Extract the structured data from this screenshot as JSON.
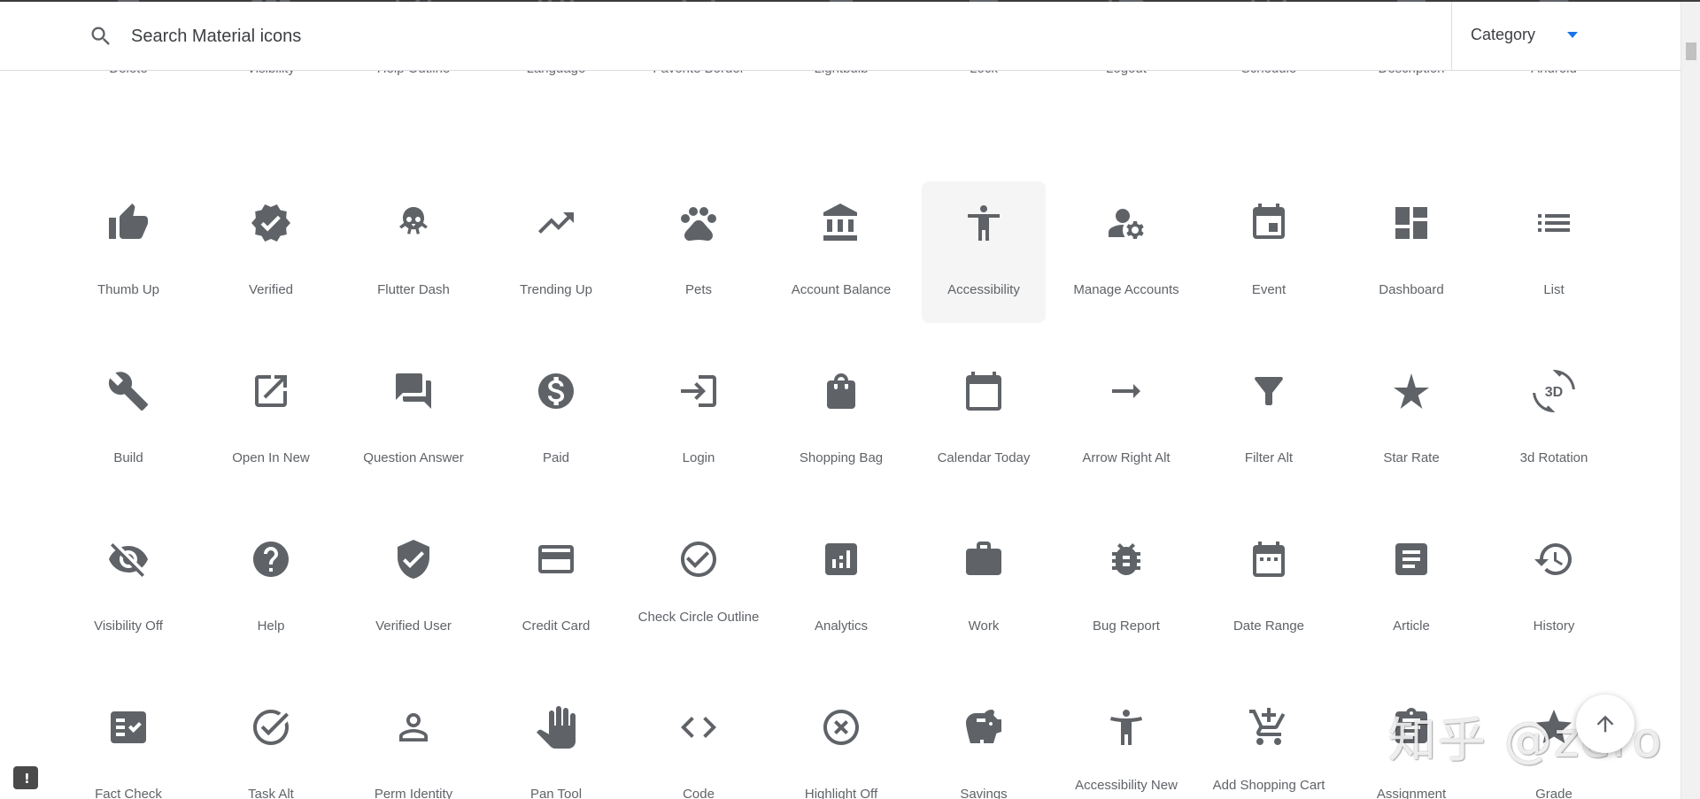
{
  "search": {
    "placeholder": "Search Material icons",
    "icon": "search-icon"
  },
  "category": {
    "label": "Category",
    "accent_color": "#1a73e8"
  },
  "selected_icon": "Accessibility",
  "icon_color": "#5f6368",
  "rows": [
    [
      {
        "label": "Delete",
        "icon": "delete-icon"
      },
      {
        "label": "Visibility",
        "icon": "visibility-icon"
      },
      {
        "label": "Help Outline",
        "icon": "help-outline-icon"
      },
      {
        "label": "Language",
        "icon": "language-icon"
      },
      {
        "label": "Favorite Border",
        "icon": "favorite-border-icon"
      },
      {
        "label": "Lightbulb",
        "icon": "lightbulb-icon"
      },
      {
        "label": "Lock",
        "icon": "lock-icon"
      },
      {
        "label": "Logout",
        "icon": "logout-icon"
      },
      {
        "label": "Schedule",
        "icon": "schedule-icon"
      },
      {
        "label": "Description",
        "icon": "description-icon"
      },
      {
        "label": "Android",
        "icon": "android-icon"
      }
    ],
    [
      {
        "label": "Thumb Up",
        "icon": "thumb-up-icon"
      },
      {
        "label": "Verified",
        "icon": "verified-icon"
      },
      {
        "label": "Flutter Dash",
        "icon": "flutter-dash-icon"
      },
      {
        "label": "Trending Up",
        "icon": "trending-up-icon"
      },
      {
        "label": "Pets",
        "icon": "pets-icon"
      },
      {
        "label": "Account Balance",
        "icon": "account-balance-icon"
      },
      {
        "label": "Accessibility",
        "icon": "accessibility-icon"
      },
      {
        "label": "Manage Accounts",
        "icon": "manage-accounts-icon"
      },
      {
        "label": "Event",
        "icon": "event-icon"
      },
      {
        "label": "Dashboard",
        "icon": "dashboard-icon"
      },
      {
        "label": "List",
        "icon": "list-icon"
      }
    ],
    [
      {
        "label": "Build",
        "icon": "build-icon"
      },
      {
        "label": "Open In New",
        "icon": "open-in-new-icon"
      },
      {
        "label": "Question Answer",
        "icon": "question-answer-icon"
      },
      {
        "label": "Paid",
        "icon": "paid-icon"
      },
      {
        "label": "Login",
        "icon": "login-icon"
      },
      {
        "label": "Shopping Bag",
        "icon": "shopping-bag-icon"
      },
      {
        "label": "Calendar Today",
        "icon": "calendar-today-icon"
      },
      {
        "label": "Arrow Right Alt",
        "icon": "arrow-right-alt-icon"
      },
      {
        "label": "Filter Alt",
        "icon": "filter-alt-icon"
      },
      {
        "label": "Star Rate",
        "icon": "star-rate-icon"
      },
      {
        "label": "3d Rotation",
        "icon": "3d-rotation-icon"
      }
    ],
    [
      {
        "label": "Visibility Off",
        "icon": "visibility-off-icon"
      },
      {
        "label": "Help",
        "icon": "help-icon"
      },
      {
        "label": "Verified User",
        "icon": "verified-user-icon"
      },
      {
        "label": "Credit Card",
        "icon": "credit-card-icon"
      },
      {
        "label": "Check Circle Outline",
        "icon": "check-circle-outline-icon"
      },
      {
        "label": "Analytics",
        "icon": "analytics-icon"
      },
      {
        "label": "Work",
        "icon": "work-icon"
      },
      {
        "label": "Bug Report",
        "icon": "bug-report-icon"
      },
      {
        "label": "Date Range",
        "icon": "date-range-icon"
      },
      {
        "label": "Article",
        "icon": "article-icon"
      },
      {
        "label": "History",
        "icon": "history-icon"
      }
    ],
    [
      {
        "label": "Fact Check",
        "icon": "fact-check-icon"
      },
      {
        "label": "Task Alt",
        "icon": "task-alt-icon"
      },
      {
        "label": "Perm Identity",
        "icon": "perm-identity-icon"
      },
      {
        "label": "Pan Tool",
        "icon": "pan-tool-icon"
      },
      {
        "label": "Code",
        "icon": "code-icon"
      },
      {
        "label": "Highlight Off",
        "icon": "highlight-off-icon"
      },
      {
        "label": "Savings",
        "icon": "savings-icon"
      },
      {
        "label": "Accessibility New",
        "icon": "accessibility-new-icon"
      },
      {
        "label": "Add Shopping Cart",
        "icon": "add-shopping-cart-icon"
      },
      {
        "label": "Assignment",
        "icon": "assignment-icon"
      },
      {
        "label": "Grade",
        "icon": "grade-icon"
      }
    ]
  ],
  "feedback": {
    "glyph": "!",
    "icon": "feedback-icon"
  },
  "back_to_top": {
    "icon": "arrow-upward-icon"
  },
  "watermark": {
    "text": "知乎 @zero"
  }
}
